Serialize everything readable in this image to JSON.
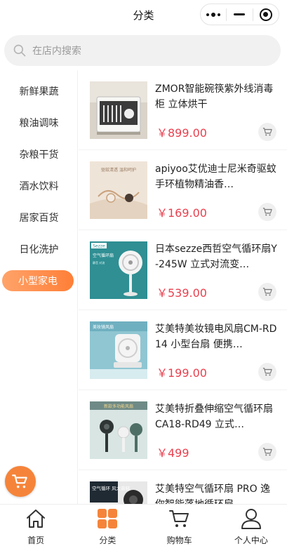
{
  "header": {
    "title": "分类"
  },
  "search": {
    "placeholder": "在店内搜索"
  },
  "sidebar": {
    "items": [
      {
        "label": "新鲜果蔬",
        "active": false
      },
      {
        "label": "粮油调味",
        "active": false
      },
      {
        "label": "杂粮干货",
        "active": false
      },
      {
        "label": "酒水饮料",
        "active": false
      },
      {
        "label": "居家百货",
        "active": false
      },
      {
        "label": "日化洗护",
        "active": false
      },
      {
        "label": "小型家电",
        "active": true
      }
    ]
  },
  "products": [
    {
      "name": "ZMOR智能碗筷紫外线消毒柜 立体烘干",
      "price": "￥899.00"
    },
    {
      "name": "apiyoo艾优迪士尼米奇驱蚊手环植物精油香…",
      "price": "￥169.00"
    },
    {
      "name": "日本sezze西哲空气循环扇Y-245W 立式对流变…",
      "price": "￥539.00"
    },
    {
      "name": "艾美特美妆镜电风扇CM-RD14 小型台扇 便携…",
      "price": "￥199.00"
    },
    {
      "name": "艾美特折叠伸缩空气循环扇CA18-RD49 立式…",
      "price": "￥499"
    },
    {
      "name": "艾美特空气循环扇 PRO 逸你智能落地循环扇…",
      "price": ""
    }
  ],
  "thumb_text": {
    "p2": "驱蚊清透 温和呵护",
    "p3_brand": "Sezze",
    "p3_title": "空气循环扇",
    "p3_sub": "静音 对流",
    "p4_title": "美妆镜风扇",
    "p5_title": "新款多功能风扇",
    "p6_title": "空气循环 风大音轻"
  },
  "tabbar": {
    "items": [
      {
        "label": "首页",
        "icon": "home-icon"
      },
      {
        "label": "分类",
        "icon": "category-icon",
        "active": true
      },
      {
        "label": "购物车",
        "icon": "cart-icon"
      },
      {
        "label": "个人中心",
        "icon": "user-icon"
      }
    ]
  },
  "colors": {
    "accent": "#ff8a3d",
    "price": "#e9414f"
  }
}
